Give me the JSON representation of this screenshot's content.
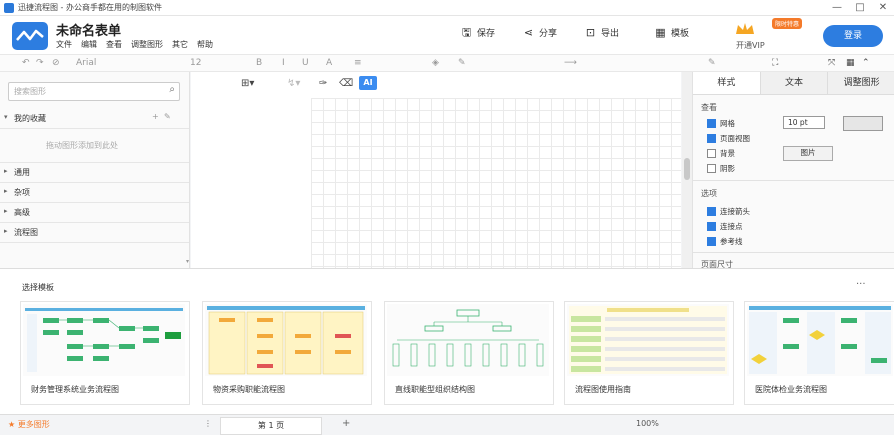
{
  "window": {
    "title": "迅捷流程图 - 办公商手都在用的制图软件",
    "controls": [
      "—",
      "□",
      "✕"
    ]
  },
  "header": {
    "doc_title": "未命名表单",
    "menu": [
      "文件",
      "编辑",
      "查看",
      "调整图形",
      "其它",
      "帮助"
    ],
    "actions": {
      "save": "保存",
      "share": "分享",
      "export": "导出",
      "template": "模板"
    },
    "vip_label": "开通VIP",
    "vip_badge": "限时特惠",
    "login": "登录"
  },
  "toolbar": {
    "font": "Arial",
    "font_size": "12",
    "bold": "B",
    "italic": "I",
    "underline": "U",
    "ai": "AI"
  },
  "sidebar": {
    "search_placeholder": "搜索图形",
    "favorites": "我的收藏",
    "favorites_hint": "拖动图形添加到此处",
    "categories": [
      "通用",
      "杂项",
      "高级",
      "流程图"
    ]
  },
  "right_panel": {
    "tabs": [
      "样式",
      "文本",
      "调整图形"
    ],
    "view_section": "查看",
    "grid": "网格",
    "grid_size": "10 pt",
    "page_view": "页面视图",
    "background": "背景",
    "background_btn": "图片",
    "shadow": "阴影",
    "options_section": "选项",
    "connection_arrows": "连接箭头",
    "connection_points": "连接点",
    "guides": "参考线",
    "paper_size": "页面尺寸"
  },
  "templates": {
    "title": "选择模板",
    "more": "···",
    "items": [
      {
        "name": "财务管理系统业务流程图"
      },
      {
        "name": "物资采购职能流程图"
      },
      {
        "name": "直线职能型组织结构图"
      },
      {
        "name": "流程图使用指南"
      },
      {
        "name": "医院体检业务流程图"
      }
    ]
  },
  "footer": {
    "shapes_label": "★ 更多图形",
    "page_tab": "第 1 页",
    "zoom": "100%"
  },
  "colors": {
    "accent": "#2d7de0",
    "vip": "#f47a2a",
    "green": "#3cb371"
  }
}
